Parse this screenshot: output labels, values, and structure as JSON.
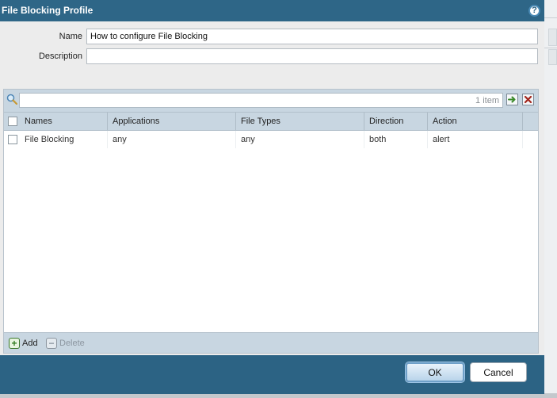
{
  "dialog": {
    "title": "File Blocking Profile",
    "help_icon": "help-icon"
  },
  "form": {
    "name_label": "Name",
    "name_value": "How to configure File Blocking",
    "description_label": "Description",
    "description_value": ""
  },
  "grid": {
    "search_value": "",
    "item_count": "1 item",
    "apply_filter_icon": "arrow-right-icon",
    "clear_filter_icon": "close-icon",
    "columns": [
      "Names",
      "Applications",
      "File Types",
      "Direction",
      "Action"
    ],
    "rows": [
      {
        "name": "File Blocking",
        "applications": "any",
        "file_types": "any",
        "direction": "both",
        "action": "alert"
      }
    ],
    "add_label": "Add",
    "delete_label": "Delete"
  },
  "buttons": {
    "ok_label": "OK",
    "cancel_label": "Cancel"
  },
  "colors": {
    "titlebar": "#2e6687",
    "grid_header": "#c8d6e1",
    "body_bg": "#ececec"
  }
}
